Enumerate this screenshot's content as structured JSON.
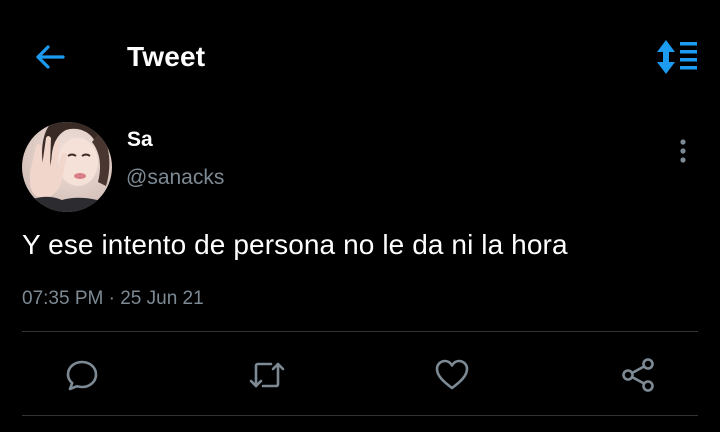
{
  "header": {
    "title": "Tweet",
    "back_icon": "arrow-left-icon",
    "sort_icon": "sort-list-icon",
    "accent_color": "#1d9bf0"
  },
  "tweet": {
    "author": {
      "name": "Sa",
      "handle": "@sanacks"
    },
    "text": "Y ese intento de persona no le da ni la hora",
    "time": "07:35 PM",
    "separator": "·",
    "date": "25 Jun 21"
  },
  "actions": [
    {
      "icon": "reply-icon"
    },
    {
      "icon": "retweet-icon"
    },
    {
      "icon": "like-icon"
    },
    {
      "icon": "share-icon"
    }
  ],
  "colors": {
    "background": "#000000",
    "text": "#ffffff",
    "secondary_text": "#7d8a94",
    "divider": "#2f3336"
  }
}
